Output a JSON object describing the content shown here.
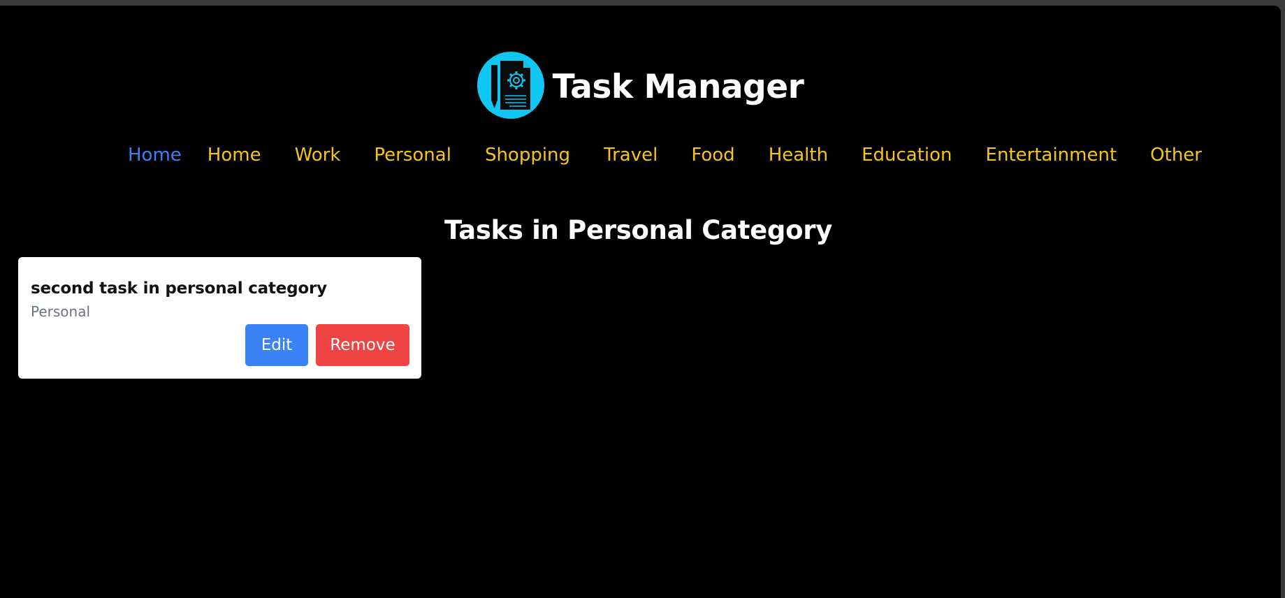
{
  "app": {
    "title": "Task Manager",
    "logo_icon": "document-gear-pencil-icon",
    "logo_color": "#0fc7f2"
  },
  "nav": {
    "items": [
      {
        "label": "Home",
        "active": true
      },
      {
        "label": "Home",
        "active": false
      },
      {
        "label": "Work",
        "active": false
      },
      {
        "label": "Personal",
        "active": false
      },
      {
        "label": "Shopping",
        "active": false
      },
      {
        "label": "Travel",
        "active": false
      },
      {
        "label": "Food",
        "active": false
      },
      {
        "label": "Health",
        "active": false
      },
      {
        "label": "Education",
        "active": false
      },
      {
        "label": "Entertainment",
        "active": false
      },
      {
        "label": "Other",
        "active": false
      }
    ],
    "active_color": "#3b82f6",
    "link_color": "#f5c518"
  },
  "main": {
    "heading": "Tasks in Personal Category",
    "tasks": [
      {
        "title": "second task in personal category",
        "category": "Personal",
        "edit_label": "Edit",
        "remove_label": "Remove"
      }
    ]
  },
  "colors": {
    "background": "#000000",
    "edit_button": "#3b82f6",
    "remove_button": "#ef4444"
  }
}
